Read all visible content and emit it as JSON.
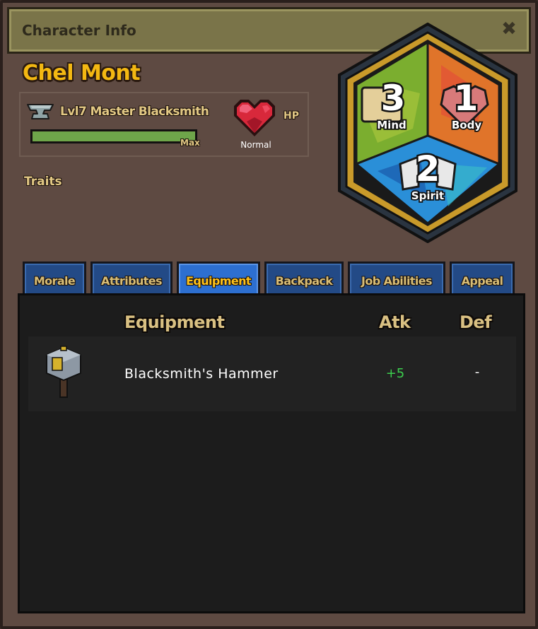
{
  "window": {
    "title": "Character Info"
  },
  "character": {
    "name": "Chel Mont",
    "job": "Lvl7 Master Blacksmith",
    "xp_fraction": 1.0,
    "xp_label": "Max",
    "hp_label": "HP",
    "hp_status": "Normal",
    "traits_label": "Traits"
  },
  "stats": {
    "mind": {
      "value": "3",
      "label": "Mind"
    },
    "body": {
      "value": "1",
      "label": "Body"
    },
    "spirit": {
      "value": "2",
      "label": "Spirit"
    }
  },
  "tabs": [
    {
      "label": "Morale",
      "active": false
    },
    {
      "label": "Attributes",
      "active": false
    },
    {
      "label": "Equipment",
      "active": true
    },
    {
      "label": "Backpack",
      "active": false
    },
    {
      "label": "Job Abilities",
      "active": false
    },
    {
      "label": "Appeal",
      "active": false
    }
  ],
  "equipment": {
    "headers": {
      "item": "Equipment",
      "atk": "Atk",
      "def": "Def"
    },
    "rows": [
      {
        "name": "Blacksmith's Hammer",
        "icon": "hammer-icon",
        "atk": "+5",
        "def": "-"
      }
    ]
  },
  "colors": {
    "name_gold": "#f3b812",
    "tab_blue": "#234a86",
    "tab_active": "#2d6fd0",
    "atk_green": "#3ccf4e",
    "xp_green": "#6ea64a"
  }
}
